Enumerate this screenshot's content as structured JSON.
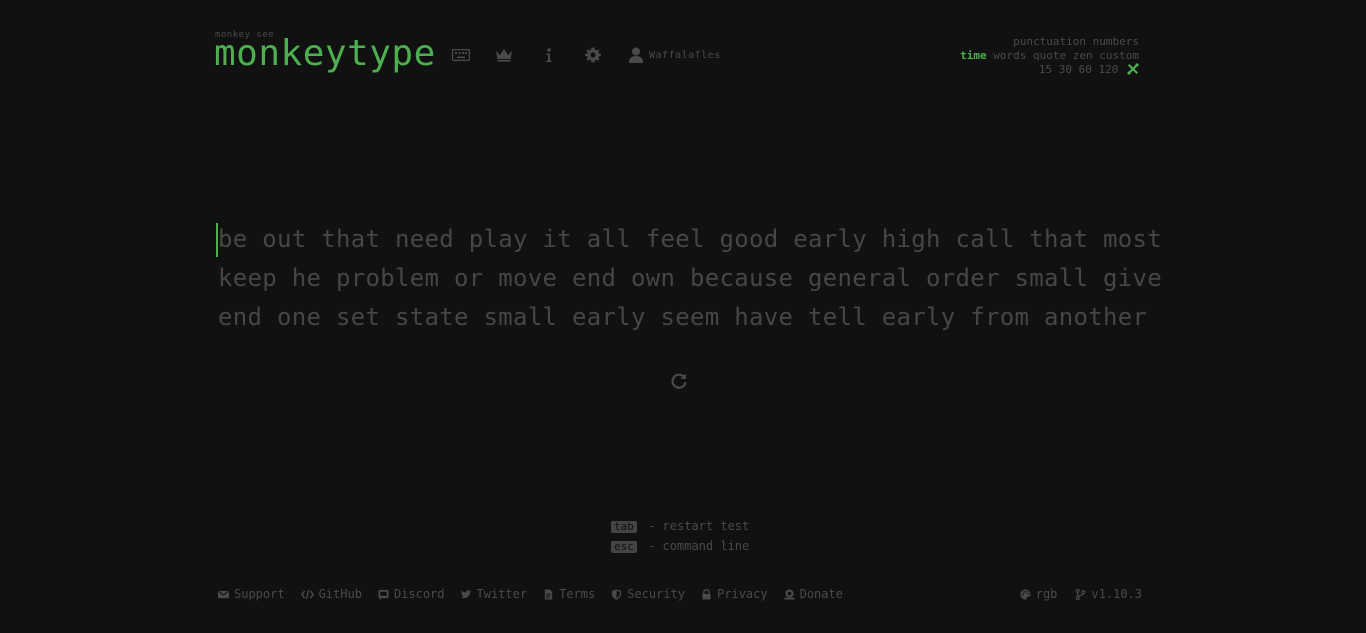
{
  "header": {
    "logo_sub": "monkey see",
    "logo_title": "monkeytype",
    "username": "Waffalafles",
    "nav_icons": [
      "keyboard-icon",
      "crown-icon",
      "info-icon",
      "gear-icon",
      "user-icon"
    ]
  },
  "config": {
    "row1": [
      "punctuation",
      "numbers"
    ],
    "row2": [
      "time",
      "words",
      "quote",
      "zen",
      "custom"
    ],
    "row2_active": "time",
    "row3": [
      "15",
      "30",
      "60",
      "120"
    ],
    "row3_tool_icon": "tools-icon"
  },
  "words": {
    "lines": [
      "be out that need play it all feel good early high call that most",
      "keep he problem or move end own because general order small give",
      "end one set state small early seem have tell early from another"
    ],
    "restart_icon": "redo-icon"
  },
  "hints": {
    "restart_key": "tab",
    "restart_text": "- restart test",
    "command_key": "esc",
    "command_text": "- command line"
  },
  "footer": {
    "links": [
      "Support",
      "GitHub",
      "Discord",
      "Twitter",
      "Terms",
      "Security",
      "Privacy",
      "Donate"
    ],
    "theme": "rgb",
    "version": "v1.10.3"
  },
  "colors": {
    "background": "#111111",
    "accent": "#4caf50",
    "text_dim": "#464646"
  }
}
